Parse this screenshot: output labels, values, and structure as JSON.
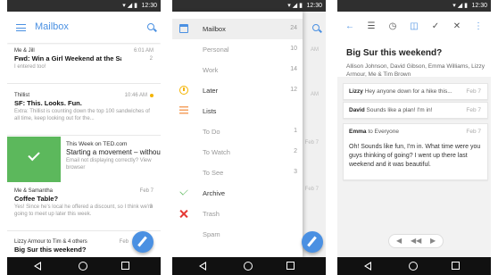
{
  "status": {
    "time": "12:30",
    "icons": "▾◢▮"
  },
  "phone1": {
    "title": "Mailbox",
    "emails": [
      {
        "from": "Me & Jill",
        "subject": "Fwd: Win a Girl Weekend at the San ...",
        "preview": "I entered too!",
        "time": "6:01 AM",
        "count": "2"
      },
      {
        "from": "Thillist",
        "subject": "SF: This. Looks. Fun.",
        "preview": "Extra: Thillist is counting down the top 100 sandwiches of all time, keep looking out for the...",
        "time": "10:46 AM",
        "count": ""
      },
      {
        "from": "Me & Samantha",
        "subject": "Coffee Table?",
        "preview": "Yes! Since he's local he offered a discount, so I think we're going to meet up later this week.",
        "time": "Feb 7",
        "count": "3"
      },
      {
        "from": "Lizzy Armour to Tim & 4 others",
        "subject": "Big Sur this weekend?",
        "preview": "",
        "time": "Feb",
        "count": ""
      }
    ],
    "swiped": {
      "from": "This Week on TED.com",
      "subject": "Starting a movement – without",
      "preview": "Email not displaying correctly? View browser"
    }
  },
  "phone2": {
    "drawer": [
      {
        "label": "Mailbox",
        "count": "24",
        "icon": "inbox-icon",
        "sub": false
      },
      {
        "label": "Personal",
        "count": "10",
        "icon": "",
        "sub": true
      },
      {
        "label": "Work",
        "count": "14",
        "icon": "",
        "sub": true
      },
      {
        "label": "Later",
        "count": "12",
        "icon": "clock-icon",
        "sub": false
      },
      {
        "label": "Lists",
        "count": "",
        "icon": "lists-icon",
        "sub": false
      },
      {
        "label": "To Do",
        "count": "1",
        "icon": "",
        "sub": true
      },
      {
        "label": "To Watch",
        "count": "2",
        "icon": "",
        "sub": true
      },
      {
        "label": "To See",
        "count": "3",
        "icon": "",
        "sub": true
      },
      {
        "label": "Archive",
        "count": "",
        "icon": "archive-icon",
        "sub": false
      },
      {
        "label": "Trash",
        "count": "",
        "icon": "trash-icon",
        "sub": true
      },
      {
        "label": "Spam",
        "count": "",
        "icon": "",
        "sub": true
      }
    ],
    "bg_times": [
      "AM",
      "AM",
      "Feb 7",
      "Feb 7"
    ]
  },
  "phone3": {
    "toolbar": {
      "back": "←",
      "list": "☰",
      "later": "◷",
      "inbox": "◫",
      "archive": "✓",
      "delete": "✕",
      "more": "⋮"
    },
    "title": "Big Sur this weekend?",
    "participants": "Allison Johnson, David Gibson, Emma Williams, Lizzy Armour, Me & Tim Brown",
    "messages": [
      {
        "sender": "Lizzy",
        "text": "Hey anyone down for a hike this...",
        "date": "Feb 7"
      },
      {
        "sender": "David",
        "text": "Sounds like a plan! I'm in!",
        "date": "Feb 7"
      }
    ],
    "open_message": {
      "sender": "Emma",
      "to": "to Everyone",
      "date": "Feb 7",
      "body": "Oh! Sounds like fun, I'm in. What time were you guys thinking of going? I went up there last weekend and it was beautiful."
    },
    "actions": {
      "reply": "◀",
      "reply_all": "◀◀",
      "forward": "▶"
    }
  },
  "colors": {
    "accent": "#4a90e2",
    "green": "#5cb85c",
    "yellow": "#f4b400",
    "red": "#e53935"
  }
}
